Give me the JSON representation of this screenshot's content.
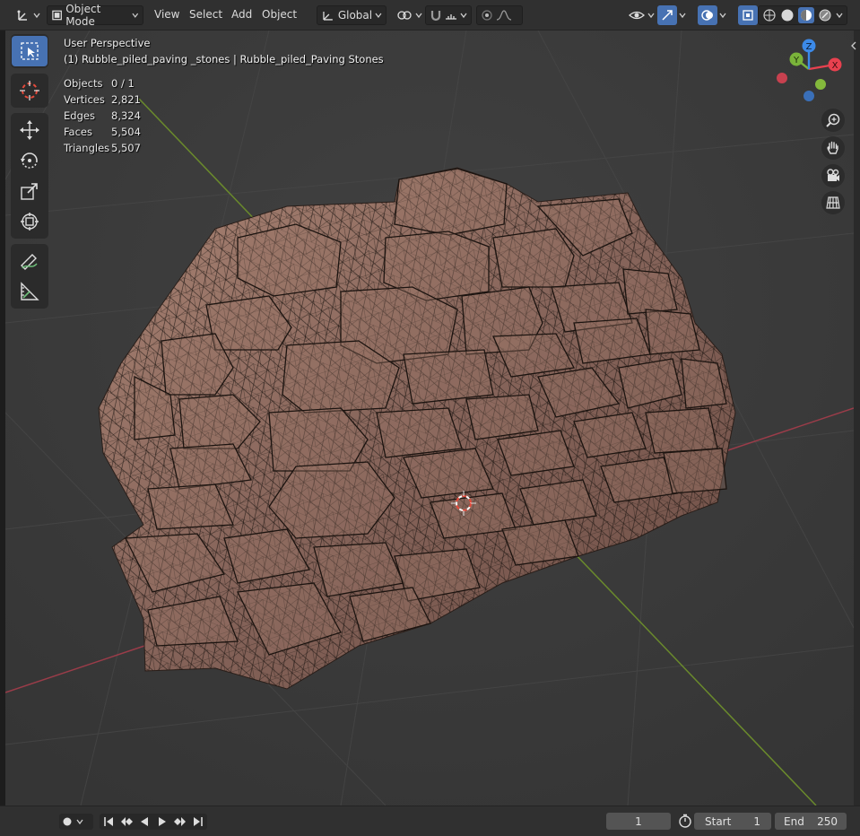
{
  "header": {
    "editor_type_icon": "axis-editor-icon",
    "mode_label": "Object Mode",
    "menus": [
      "View",
      "Select",
      "Add",
      "Object"
    ],
    "transform_orientation": "Global"
  },
  "overlay": {
    "view_name": "User Perspective",
    "object_name": "(1) Rubble_piled_paving _stones | Rubble_piled_Paving Stones"
  },
  "stats": [
    {
      "label": "Objects",
      "value": "0 / 1"
    },
    {
      "label": "Vertices",
      "value": "2,821"
    },
    {
      "label": "Edges",
      "value": "8,324"
    },
    {
      "label": "Faces",
      "value": "5,504"
    },
    {
      "label": "Triangles",
      "value": "5,507"
    }
  ],
  "gizmo": {
    "x": "X",
    "y": "Y",
    "z": "Z"
  },
  "timeline": {
    "current_frame": "1",
    "start_label": "Start",
    "start_value": "1",
    "end_label": "End",
    "end_value": "250"
  },
  "colors": {
    "accent": "#4772b3",
    "axis_x": "#e8414f",
    "axis_y": "#7ab33a",
    "axis_z": "#3c8ae8",
    "background": "#393939"
  }
}
